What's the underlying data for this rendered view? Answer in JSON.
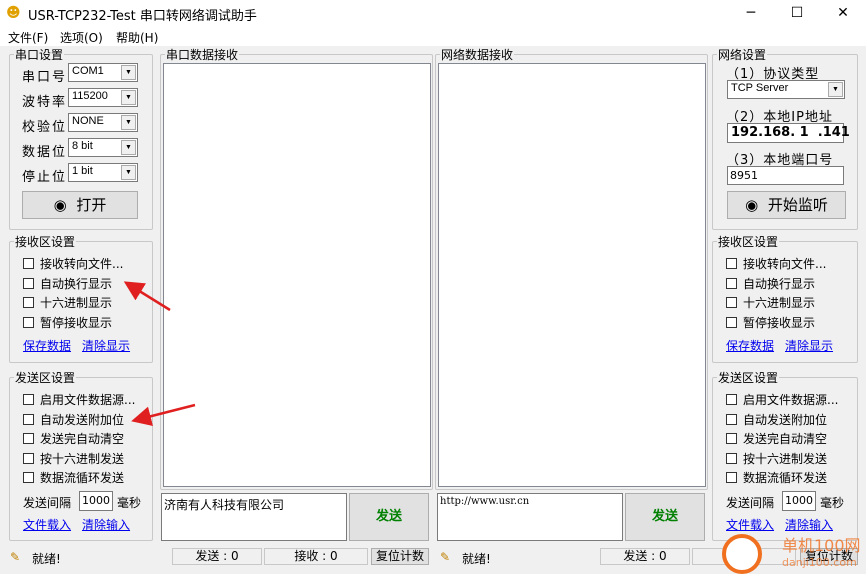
{
  "window": {
    "title": "USR-TCP232-Test 串口转网络调试助手",
    "minimize": "─",
    "maximize": "☐",
    "close": "✕"
  },
  "menu": [
    "文件(F)",
    "选项(O)",
    "帮助(H)"
  ],
  "serial": {
    "legend": "串口设置",
    "rows": [
      {
        "label": "串口号",
        "value": "COM1"
      },
      {
        "label": "波特率",
        "value": "115200"
      },
      {
        "label": "校验位",
        "value": "NONE"
      },
      {
        "label": "数据位",
        "value": "8 bit"
      },
      {
        "label": "停止位",
        "value": "1 bit"
      }
    ],
    "open_button": "打开"
  },
  "network": {
    "legend": "网络设置",
    "protocol_label": "（1）协议类型",
    "protocol": "TCP Server",
    "ip_label": "（2）本地IP地址",
    "ip": "192.168. 1  .141",
    "port_label": "（3）本地端口号",
    "port": "8951",
    "listen_button": "开始监听"
  },
  "recv_left": {
    "legend": "接收区设置",
    "options": [
      "接收转向文件...",
      "自动换行显示",
      "十六进制显示",
      "暂停接收显示"
    ],
    "save": "保存数据",
    "clear": "清除显示"
  },
  "send_left": {
    "legend": "发送区设置",
    "options": [
      "启用文件数据源...",
      "自动发送附加位",
      "发送完自动清空",
      "按十六进制发送",
      "数据流循环发送"
    ],
    "interval_label": "发送间隔",
    "interval": "1000",
    "unit": "毫秒",
    "load": "文件载入",
    "clear": "清除输入"
  },
  "recv_right": {
    "legend": "接收区设置",
    "options": [
      "接收转向文件...",
      "自动换行显示",
      "十六进制显示",
      "暂停接收显示"
    ],
    "save": "保存数据",
    "clear": "清除显示"
  },
  "send_right": {
    "legend": "发送区设置",
    "options": [
      "启用文件数据源...",
      "自动发送附加位",
      "发送完自动清空",
      "按十六进制发送",
      "数据流循环发送"
    ],
    "interval_label": "发送间隔",
    "interval": "1000",
    "unit": "毫秒",
    "load": "文件载入",
    "clear": "清除输入"
  },
  "serial_recv": {
    "legend": "串口数据接收",
    "send_text": "济南有人科技有限公司",
    "send_button": "发送"
  },
  "net_recv": {
    "legend": "网络数据接收",
    "send_text": "http://www.usr.cn",
    "send_button": "发送"
  },
  "status_left": {
    "text": "就绪!",
    "sent": "发送 : 0",
    "received": "接收 : 0",
    "reset": "复位计数"
  },
  "status_right": {
    "text": "就绪!",
    "sent": "发送 : 0",
    "received": "接收",
    "reset": "复位计数"
  },
  "watermark": {
    "name": "单机100网",
    "url": "danji100.com"
  },
  "colors": {
    "send_text": "#008000",
    "link": "#0000ee",
    "arrow": "#e02020"
  }
}
